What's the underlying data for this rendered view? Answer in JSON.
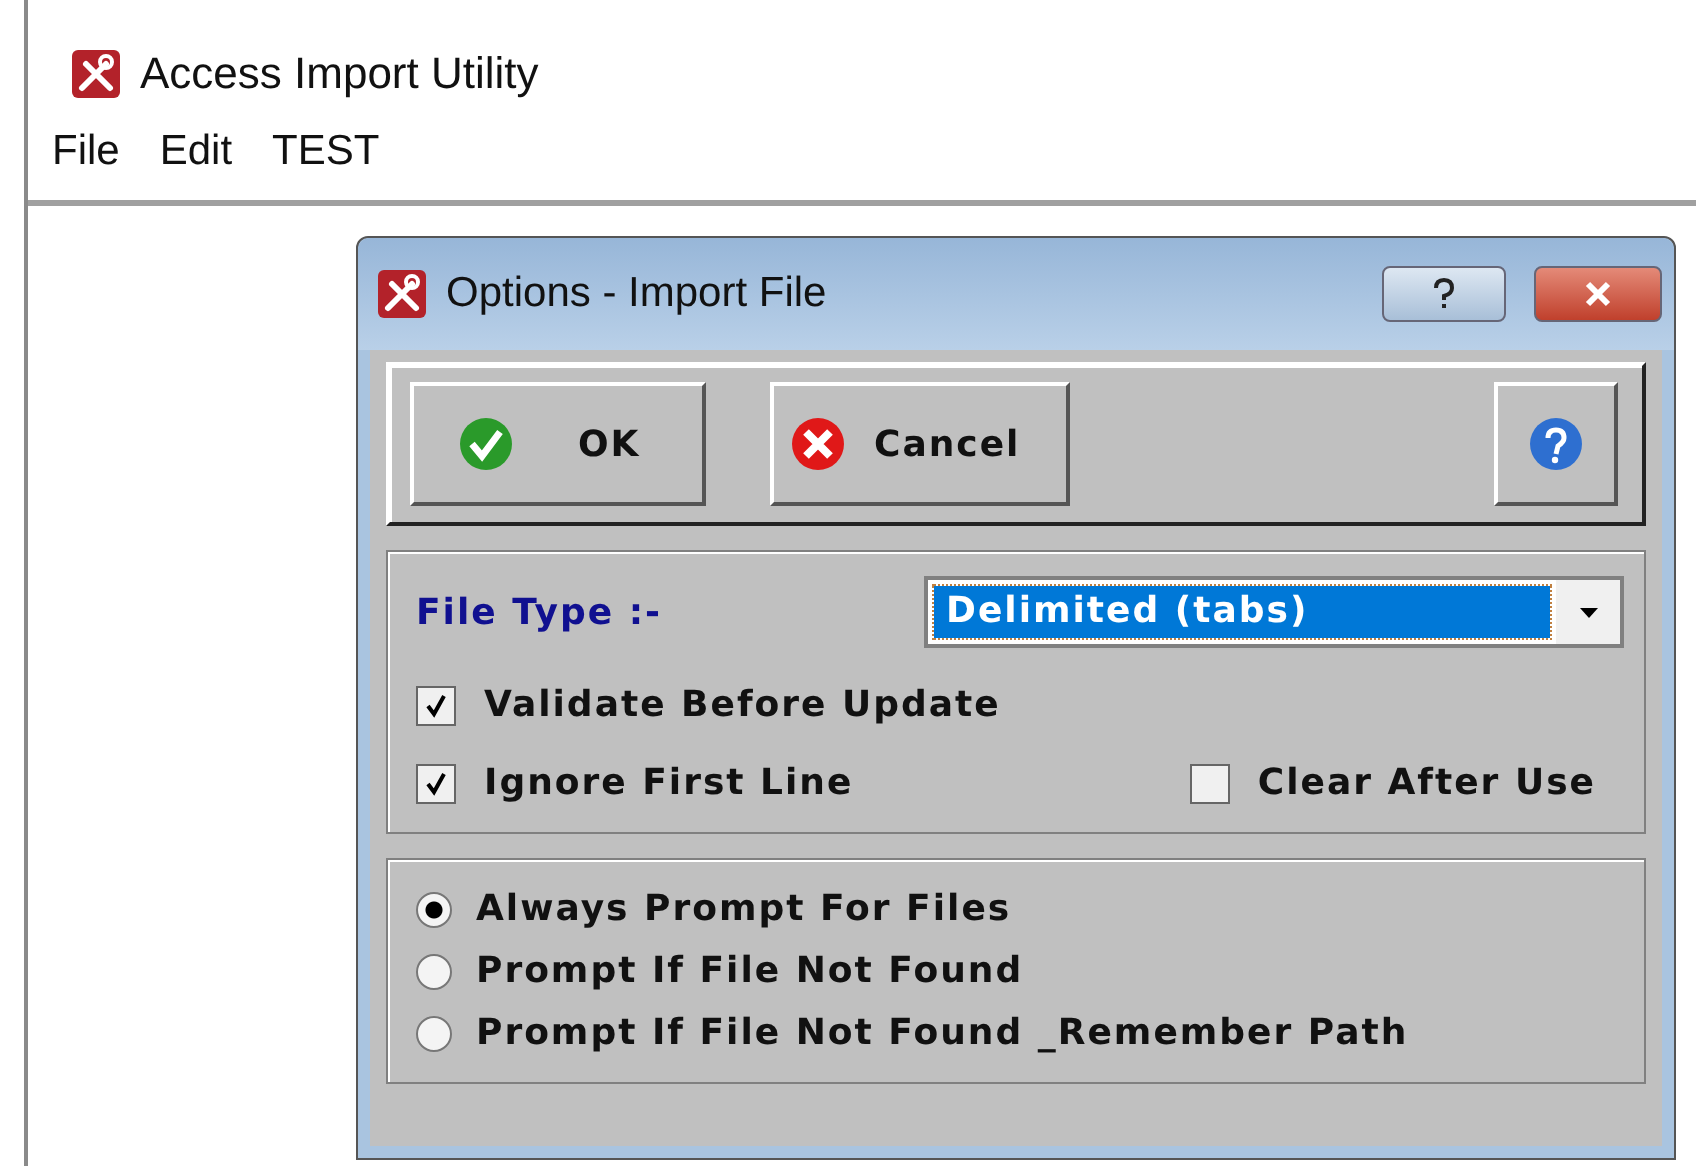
{
  "window": {
    "title": "Access Import Utility"
  },
  "menu": [
    {
      "label": "File"
    },
    {
      "label": "Edit"
    },
    {
      "label": "TEST"
    }
  ],
  "dialog": {
    "title": "Options - Import File",
    "toolbar": [
      {
        "kind": "ok",
        "label": "OK"
      },
      {
        "kind": "cancel",
        "label": "Cancel"
      },
      {
        "kind": "help"
      }
    ],
    "file_type": {
      "label": "File Type :-",
      "value": "Delimited (tabs)"
    },
    "checkboxes": [
      {
        "label": "Validate Before Update",
        "checked": true
      },
      {
        "label": "Ignore First Line",
        "checked": true
      },
      {
        "label": "Clear After Use",
        "checked": false
      }
    ],
    "radios": [
      {
        "label": "Always Prompt For Files",
        "selected": true
      },
      {
        "label": "Prompt If File Not Found",
        "selected": false
      },
      {
        "label": "Prompt If File Not Found _Remember Path",
        "selected": false
      }
    ]
  }
}
